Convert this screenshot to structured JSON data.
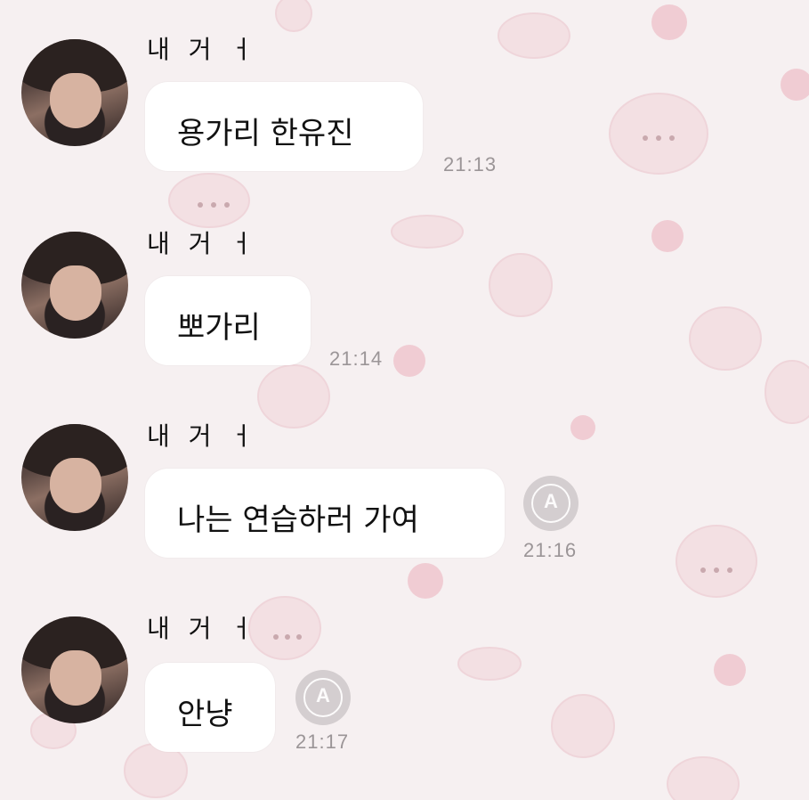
{
  "chat": {
    "messages": [
      {
        "sender": "내 거 ㅓ",
        "text": "용가리 한유진",
        "time": "21:13",
        "translated": false
      },
      {
        "sender": "내 거 ㅓ",
        "text": "뽀가리",
        "time": "21:14",
        "translated": false
      },
      {
        "sender": "내 거 ㅓ",
        "text": "나는 연습하러 가여",
        "time": "21:16",
        "translated": true
      },
      {
        "sender": "내 거 ㅓ",
        "text": "안냥",
        "time": "21:17",
        "translated": true
      }
    ],
    "translate_icon_letter": "A"
  },
  "colors": {
    "background": "#f6f0f1",
    "bubble": "#ffffff",
    "time_text": "#9b9597",
    "pattern": "#f0d9dd"
  },
  "icons": {
    "avatar": "profile-photo",
    "translate": "translate-icon"
  }
}
